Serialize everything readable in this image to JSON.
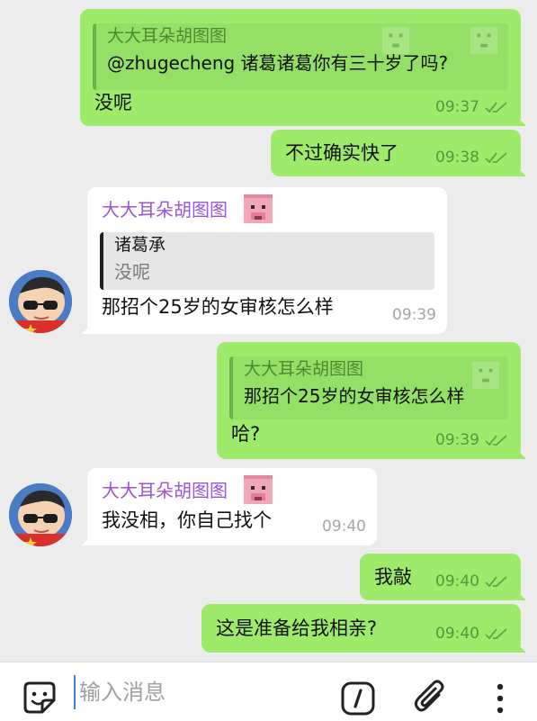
{
  "messages": [
    {
      "side": "outgoing",
      "reply_to": {
        "name": "大大耳朵胡图图",
        "text": "@zhugecheng 诸葛诸葛你有三十岁了吗?"
      },
      "text": "没呢",
      "time": "09:37"
    },
    {
      "side": "outgoing",
      "text": "不过确实快了",
      "time": "09:38"
    },
    {
      "side": "incoming",
      "sender": "大大耳朵胡图图",
      "reply_to": {
        "name": "诸葛承",
        "text": "没呢"
      },
      "text": "那招个25岁的女审核怎么样",
      "time": "09:39"
    },
    {
      "side": "outgoing",
      "reply_to": {
        "name": "大大耳朵胡图图",
        "text": "那招个25岁的女审核怎么样"
      },
      "text": "哈?",
      "time": "09:39"
    },
    {
      "side": "incoming",
      "sender": "大大耳朵胡图图",
      "text": "我没相，你自己找个",
      "time": "09:40"
    },
    {
      "side": "outgoing",
      "text": "我敲",
      "time": "09:40"
    },
    {
      "side": "outgoing",
      "text": "这是准备给我相亲?",
      "time": "09:40"
    }
  ],
  "composer": {
    "placeholder": "输入消息",
    "icons": [
      "sticker-icon",
      "command-icon",
      "attach-icon",
      "more-icon"
    ]
  },
  "colors": {
    "outgoing_bubble": "#9eea6a",
    "incoming_bubble": "#ffffff",
    "sender_name": "#9a55d8",
    "background": "#ececec"
  }
}
